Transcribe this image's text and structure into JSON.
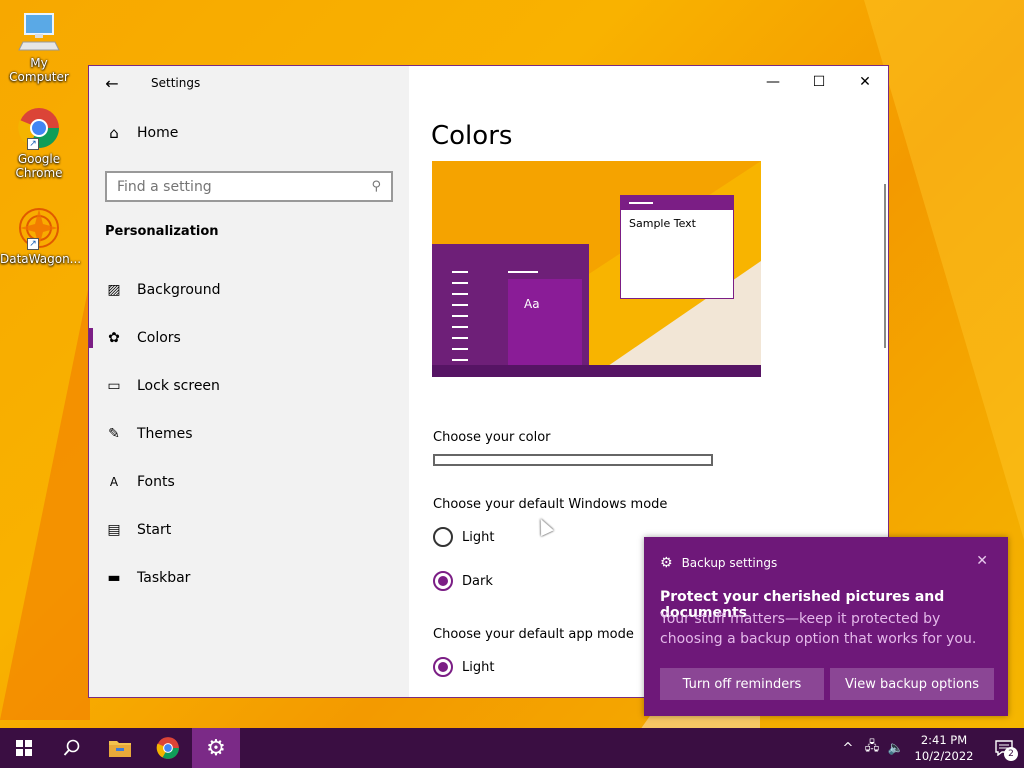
{
  "desktop": {
    "icons": [
      {
        "label": "My Computer"
      },
      {
        "label": "Google Chrome"
      },
      {
        "label": "DataWagon..."
      }
    ]
  },
  "window": {
    "title": "Settings",
    "home_label": "Home",
    "search_placeholder": "Find a setting",
    "section_label": "Personalization",
    "nav_items": [
      {
        "label": "Background",
        "icon": "image-icon"
      },
      {
        "label": "Colors",
        "icon": "palette-icon",
        "active": true
      },
      {
        "label": "Lock screen",
        "icon": "lock-screen-icon"
      },
      {
        "label": "Themes",
        "icon": "themes-icon"
      },
      {
        "label": "Fonts",
        "icon": "fonts-icon"
      },
      {
        "label": "Start",
        "icon": "start-icon"
      },
      {
        "label": "Taskbar",
        "icon": "taskbar-icon"
      }
    ]
  },
  "content": {
    "page_title": "Colors",
    "preview": {
      "tile_text": "Aa",
      "sample_text": "Sample Text"
    },
    "choose_color_label": "Choose your color",
    "windows_mode": {
      "label": "Choose your default Windows mode",
      "options": [
        {
          "label": "Light",
          "checked": false
        },
        {
          "label": "Dark",
          "checked": true
        }
      ]
    },
    "app_mode": {
      "label": "Choose your default app mode",
      "options": [
        {
          "label": "Light",
          "checked": true
        }
      ]
    }
  },
  "toast": {
    "app_name": "Backup settings",
    "title": "Protect your cherished pictures and documents",
    "body": "Your stuff matters—keep it protected by choosing a backup option that works for you.",
    "buttons": [
      {
        "label": "Turn off reminders"
      },
      {
        "label": "View backup options"
      }
    ]
  },
  "taskbar": {
    "time": "2:41 PM",
    "date": "10/2/2022",
    "notification_count": "2"
  },
  "colors": {
    "accent": "#7b1e85",
    "taskbar": "#3a0e42",
    "toast_bg": "#6e1879"
  }
}
